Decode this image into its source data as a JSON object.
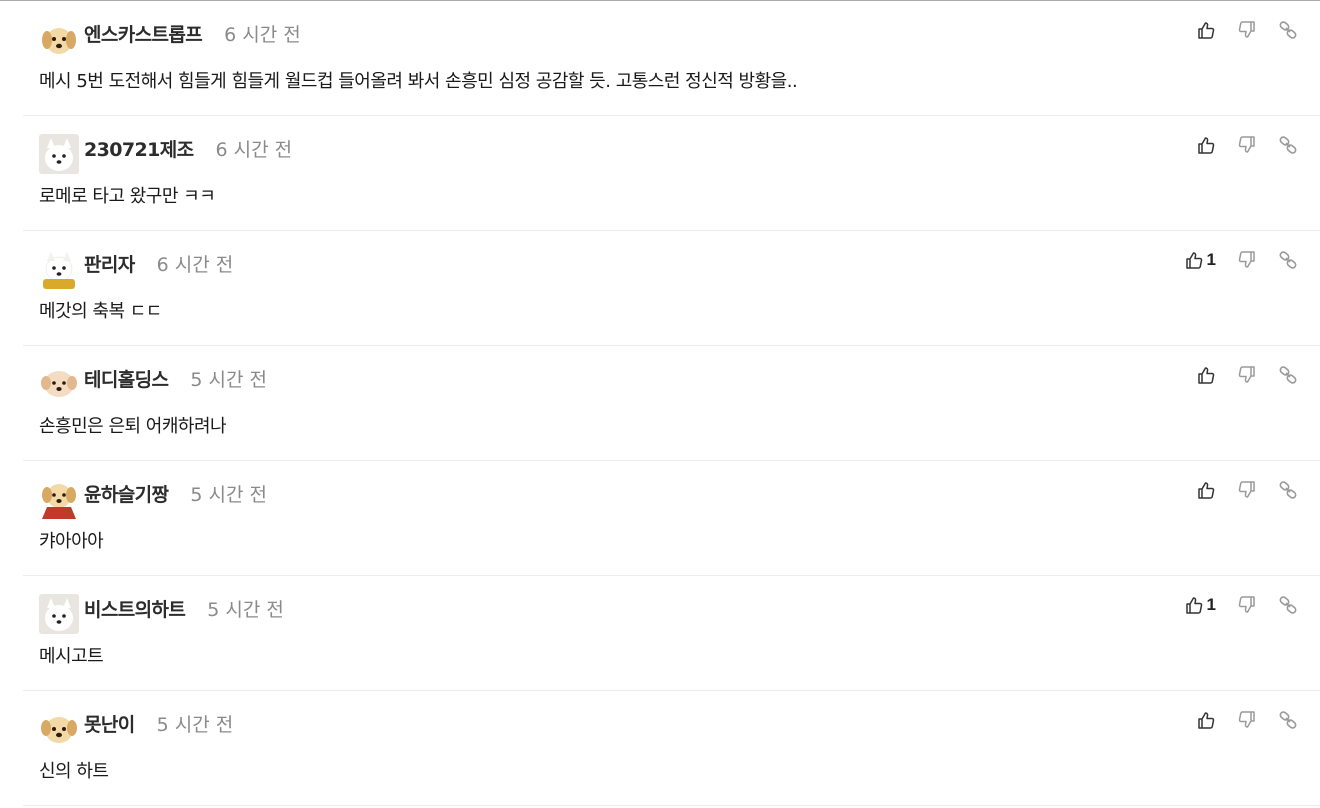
{
  "colors": {
    "name": "#2c2c2c",
    "time": "#8a8a8a",
    "text": "#1a1a1a",
    "divider": "#ececec",
    "icon": "#333333",
    "icon_muted": "#9a9a9a"
  },
  "comments": [
    {
      "author": "엔스카스트롭프",
      "time": "6 시간 전",
      "text": "메시 5번 도전해서 힘들게 힘들게 월드컵 들어올려 봐서 손흥민 심정 공감할 듯. 고통스런 정신적 방황을..",
      "likes": "",
      "avatar": "puppy-icon"
    },
    {
      "author": "230721제조",
      "time": "6 시간 전",
      "text": "로메로 타고 왔구만 ㅋㅋ",
      "likes": "",
      "avatar": "white-dog-icon"
    },
    {
      "author": "판리자",
      "time": "6 시간 전",
      "text": "메갓의 축복 ㄷㄷ",
      "likes": "1",
      "avatar": "white-dog-icon"
    },
    {
      "author": "테디홀딩스",
      "time": "5 시간 전",
      "text": "손흥민은 은퇴 어캐하려나",
      "likes": "",
      "avatar": "puppy-icon"
    },
    {
      "author": "윤하슬기짱",
      "time": "5 시간 전",
      "text": "캬아아아",
      "likes": "",
      "avatar": "puppy-icon"
    },
    {
      "author": "비스트의하트",
      "time": "5 시간 전",
      "text": "메시고트",
      "likes": "1",
      "avatar": "white-dog-icon"
    },
    {
      "author": "못난이",
      "time": "5 시간 전",
      "text": "신의 하트",
      "likes": "",
      "avatar": "puppy-icon"
    }
  ]
}
